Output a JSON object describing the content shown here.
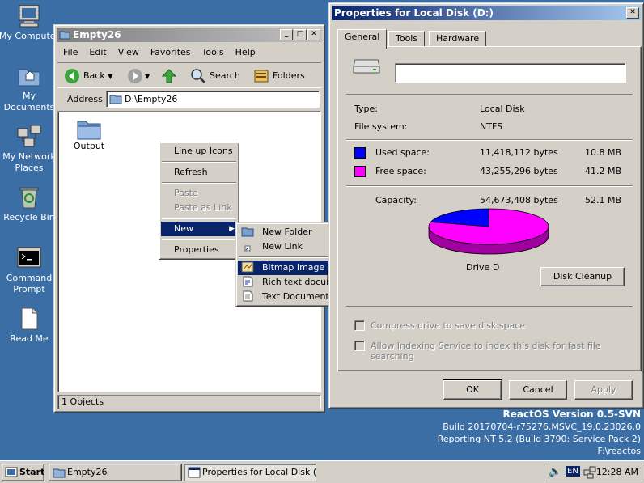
{
  "desktop": {
    "icons": [
      {
        "label": "My Computer"
      },
      {
        "label": "My Documents"
      },
      {
        "label": "My Network Places"
      },
      {
        "label": "Recycle Bin"
      },
      {
        "label": "Command Prompt"
      },
      {
        "label": "Read Me"
      }
    ],
    "watermark": {
      "line1": "ReactOS Version 0.5-SVN",
      "line2": "Build 20170704-r75276.MSVC_19.0.23026.0",
      "line3": "Reporting NT 5.2 (Build 3790: Service Pack 2)",
      "line4": "F:\\reactos"
    }
  },
  "explorer": {
    "title": "Empty26",
    "menu": [
      "File",
      "Edit",
      "View",
      "Favorites",
      "Tools",
      "Help"
    ],
    "toolbar": {
      "back": "Back",
      "search": "Search",
      "folders": "Folders"
    },
    "address_label": "Address",
    "address_value": "D:\\Empty26",
    "items": [
      {
        "label": "Output"
      }
    ],
    "status": "1 Objects"
  },
  "context_menu": {
    "items": [
      "Line up Icons",
      "Refresh",
      "Paste",
      "Paste as Link",
      "New",
      "Properties"
    ]
  },
  "new_submenu": {
    "items": [
      "New Folder",
      "New Link",
      "Bitmap Image",
      "Rich text document",
      "Text Document"
    ]
  },
  "properties": {
    "title": "Properties for Local Disk (D:)",
    "tabs": [
      "General",
      "Tools",
      "Hardware"
    ],
    "label_value": "",
    "type_label": "Type:",
    "type_value": "Local Disk",
    "fs_label": "File system:",
    "fs_value": "NTFS",
    "used_label": "Used space:",
    "used_bytes": "11,418,112 bytes",
    "used_mb": "10.8 MB",
    "free_label": "Free space:",
    "free_bytes": "43,255,296 bytes",
    "free_mb": "41.2 MB",
    "capacity_label": "Capacity:",
    "capacity_bytes": "54,673,408 bytes",
    "capacity_mb": "52.1 MB",
    "drive_label": "Drive D",
    "disk_cleanup": "Disk Cleanup",
    "compress_label": "Compress drive to save disk space",
    "index_label": "Allow Indexing Service to index this disk for fast file searching",
    "ok": "OK",
    "cancel": "Cancel",
    "apply": "Apply",
    "used_fraction": 0.2088,
    "colors": {
      "used": "#0000ff",
      "free": "#ff00ff"
    }
  },
  "taskbar": {
    "start": "Start",
    "tasks": [
      "Empty26",
      "Properties for Local Disk (D:)"
    ],
    "lang": "EN",
    "clock": "12:28 AM"
  }
}
